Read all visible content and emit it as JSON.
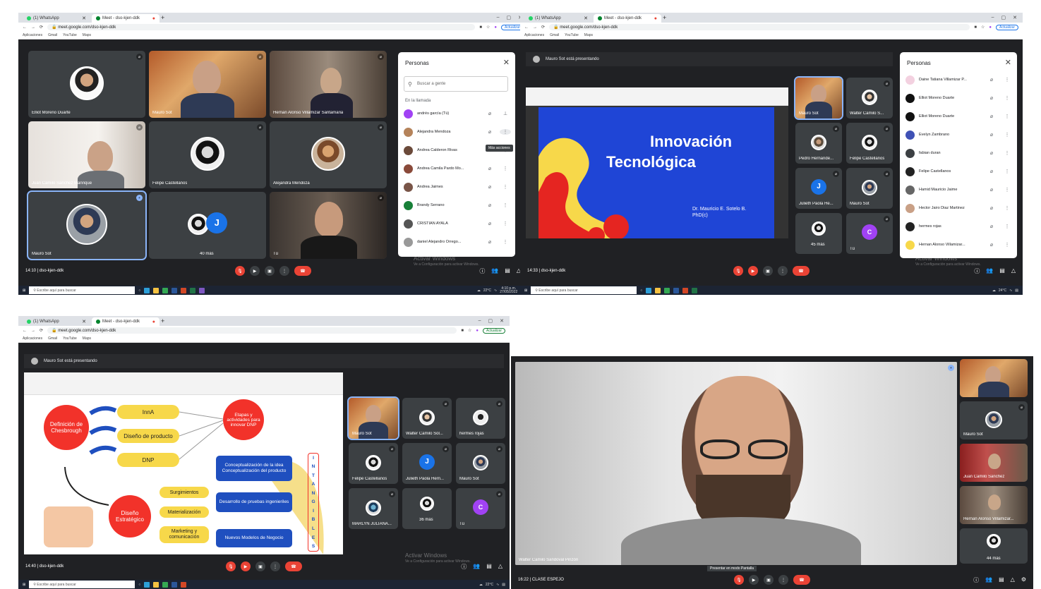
{
  "browser": {
    "tab_whatsapp": "(1) WhatsApp",
    "tab_meet": "Meet - dso-kjen-ddk",
    "tab_new": "+",
    "url": "meet.google.com/dso-kjen-ddk",
    "update_btn": "Actualizar",
    "bookmarks": [
      "Aplicaciones",
      "Gmail",
      "YouTube",
      "Maps"
    ]
  },
  "shot1": {
    "tiles": [
      {
        "name": "Elliot Moreno Duarte"
      },
      {
        "name": "Mauro Sot"
      },
      {
        "name": "Hernan Alonso Villamizar Santamaria"
      },
      {
        "name": "Juan Camilo Sanchez Manrique"
      },
      {
        "name": "Felipe Castellanos"
      },
      {
        "name": "Alejandra Mendoza"
      },
      {
        "name": "Mauro Sot"
      },
      {
        "name": "40 más",
        "letter": "J"
      },
      {
        "name": "Tú"
      }
    ],
    "time_code": "14:10 | dso-kjen-ddk",
    "people_panel": {
      "title": "Personas",
      "search_placeholder": "Buscar a gente",
      "section": "En la llamada",
      "tooltip": "Más acciones",
      "people": [
        "andrés garcía (Tú)",
        "Alejandra Mendoza",
        "Andrea Calderon Rivas",
        "Andrea Camila Pardo Mo...",
        "Andrea Jaimes",
        "Brandy Serrano",
        "CRISTIAN AYALA",
        "daniel Alejandro Orrego..."
      ]
    }
  },
  "shot2": {
    "presenter_banner": "Mauro Sot está presentando",
    "slide_title_line1": "Innovación",
    "slide_title_line2": "Tecnológica",
    "slide_author_line1": "Dr. Mauricio E. Sotelo B.",
    "slide_author_line2": "PhD(c)",
    "tiles": [
      {
        "name": "Mauro Sot"
      },
      {
        "name": "Walter Camilo S..."
      },
      {
        "name": "Pedro Hernande..."
      },
      {
        "name": "Felipe Castellanos"
      },
      {
        "name": "Julieth Paola He...",
        "letter": "J"
      },
      {
        "name": "Mauro Sot"
      },
      {
        "name": "45 más"
      },
      {
        "name": "Tú",
        "letter": "C"
      }
    ],
    "time_code": "14:33 | dso-kjen-ddk",
    "people_panel": {
      "title": "Personas",
      "people": [
        "Daine Tatiana Villamizar P...",
        "Elliot Moreno Duarte",
        "Elliot Moreno Duarte",
        "Evelyn Zambrano",
        "fabian duran",
        "Felipe Castellanos",
        "Hamid Mauricio Jaime",
        "Hector Jairo Diaz Martinez",
        "hermes rojas",
        "Hernan Alonso Villamizar..."
      ]
    }
  },
  "shot3": {
    "presenter_banner": "Mauro Sot está presentando",
    "diagram": {
      "definition": "Definición de Chesbrough",
      "steps_bubble": "Etapas y actividades para innovar DNP",
      "strategic": "Diseño Estratégico",
      "yellow_top": [
        "InnA",
        "Diseño de producto",
        "DNP"
      ],
      "yellow_bottom": [
        "Surgimientos",
        "Materialización",
        "Marketing y comunicación"
      ],
      "blue_boxes": [
        "Conceptualización de la idea Conceptualización del producto",
        "Desarrollo de pruebas ingenieriles",
        "Nuevos Modelos de Negocio"
      ],
      "vertical_word": [
        "I",
        "N",
        "T",
        "A",
        "N",
        "G",
        "I",
        "B",
        "L",
        "E",
        "S"
      ]
    },
    "tiles": [
      {
        "name": "Mauro Sot"
      },
      {
        "name": "Walter Camilo Sol..."
      },
      {
        "name": "hermes rojas"
      },
      {
        "name": "Felipe Castellanos"
      },
      {
        "name": "Julieth Paola Hern...",
        "letter": "J"
      },
      {
        "name": "Mauro Sot"
      },
      {
        "name": "MARLYN JULIANA..."
      },
      {
        "name": "36 más"
      },
      {
        "name": "Tú",
        "letter": "C"
      }
    ],
    "time_code": "14:40 | dso-kjen-ddk"
  },
  "shot4": {
    "main_name": "Walter Camilo Sandoval Pinzón",
    "tiles": [
      {
        "name": ""
      },
      {
        "name": "Mauro Sot"
      },
      {
        "name": "Juan Camilo Sanchez"
      },
      {
        "name": "Hernan Alonso Villamizar..."
      },
      {
        "name": "44 más"
      }
    ],
    "time_code": "16:22 | CLASE ESPEJO",
    "caption_hint": "Presentar en modo Pantalla"
  },
  "windows": {
    "activate_line1": "Activar Windows",
    "activate_line2": "Ve a Configuración para activar Windows.",
    "search_placeholder": "Escribe aquí para buscar",
    "temp1": "22°C",
    "temp2": "24°C",
    "clock1": "4:10 p.m.",
    "date1": "27/05/2022"
  },
  "colors": {
    "meet_bg": "#202124",
    "tile_bg": "#3c4043",
    "red": "#ea4335",
    "blue": "#1a73e8",
    "slide_blue": "#1f45d6",
    "slide_yellow": "#f7d84a"
  }
}
